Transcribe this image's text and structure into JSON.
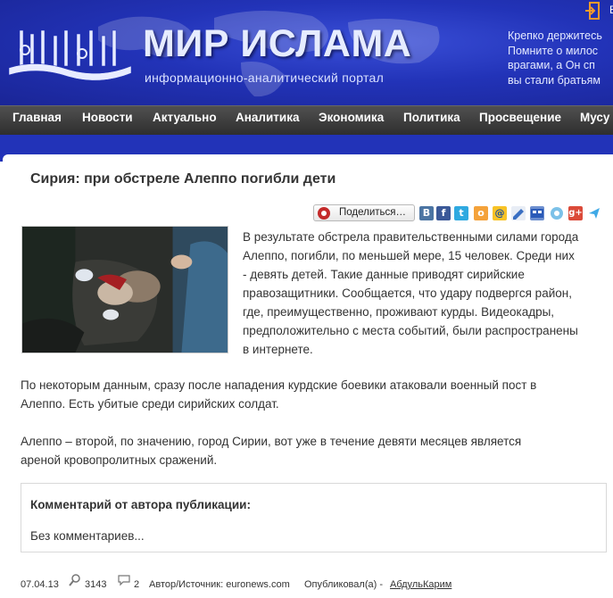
{
  "header": {
    "site_title": "МИР ИСЛАМА",
    "site_subtitle": "информационно-аналитический портал",
    "login_text": "В",
    "quote_lines": [
      "Крепко держитесь",
      "Помните о милос",
      "врагами, а Он сп",
      "вы стали братьям"
    ]
  },
  "nav": {
    "items": [
      "Главная",
      "Новости",
      "Актуально",
      "Аналитика",
      "Экономика",
      "Политика",
      "Просвещение",
      "Мусу"
    ]
  },
  "article": {
    "title": "Сирия: при обстреле Алеппо погибли дети",
    "share_label": "Поделиться…",
    "social_icons": [
      "vk-icon",
      "facebook-icon",
      "twitter-icon",
      "odnoklassniki-icon",
      "mail-icon",
      "livejournal-icon",
      "myworld-icon",
      "liveinternet-icon",
      "google-plus-icon",
      "yandex-icon"
    ],
    "intro_lines": [
      "В результате обстрела правительственными силами города",
      "Алеппо, погибли, по меньшей мере, 15 человек. Среди них",
      "- девять детей. Такие данные приводят сирийские",
      "правозащитники. Сообщается, что удару подвергся район,",
      "где, преимущественно, проживают курды. Видеокадры,",
      "предположительно с места событий, были распространены",
      "в интернете."
    ],
    "para2_lines": [
      "По некоторым данным, сразу после нападения курдские боевики атаковали военный пост в",
      "Алеппо. Есть убитые среди сирийских солдат."
    ],
    "para3_lines": [
      "Алеппо – второй, по значению, город Сирии, вот уже в течение девяти месяцев является",
      "ареной кровопролитных сражений."
    ]
  },
  "comment": {
    "title": "Комментарий от автора публикации:",
    "text": "Без комментариев..."
  },
  "meta": {
    "date": "07.04.13",
    "views": "3143",
    "comments": "2",
    "source": "Автор/Источник: euronews.com",
    "published_by_label": "Опубликовал(а) - ",
    "author": "АбдульКарим"
  },
  "colors": {
    "header_blue": "#2233b8",
    "nav_dark": "#3a3a3a"
  }
}
